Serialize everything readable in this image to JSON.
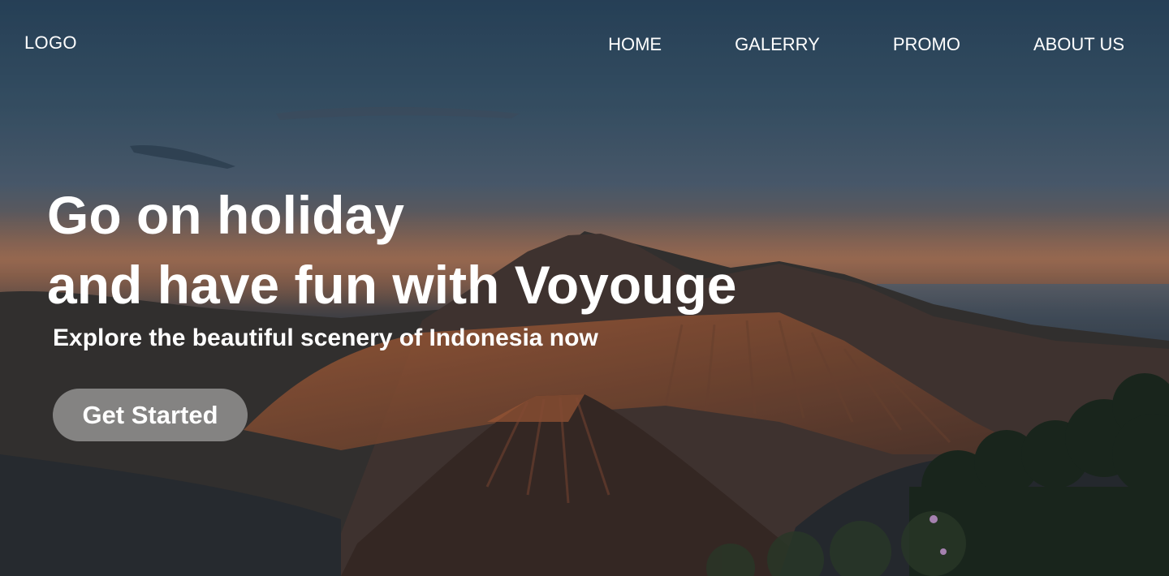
{
  "nav": {
    "logo": "LOGO",
    "items": [
      {
        "label": "HOME"
      },
      {
        "label": "GALERRY"
      },
      {
        "label": "PROMO"
      },
      {
        "label": "ABOUT US"
      }
    ]
  },
  "hero": {
    "headline_line1": "Go on holiday",
    "headline_line2": "and have fun with Voyouge",
    "subtitle": "Explore the beautiful scenery of Indonesia now",
    "cta_label": "Get Started"
  },
  "colors": {
    "text": "#ffffff",
    "button_bg": "rgba(200,200,200,0.55)"
  }
}
